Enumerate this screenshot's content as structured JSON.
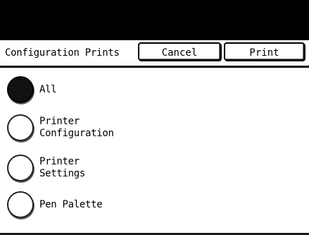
{
  "header": {
    "title": "Configuration Prints",
    "cancel_label": "Cancel",
    "print_label": "Print"
  },
  "options": [
    {
      "line1": "All",
      "selected": true
    },
    {
      "line1": "Printer",
      "line2": "Configuration",
      "selected": false
    },
    {
      "line1": "Printer",
      "line2": "Settings",
      "selected": false
    },
    {
      "line1": "Pen Palette",
      "selected": false
    }
  ],
  "colors": {
    "top_bar": "#000000",
    "background": "#ffffff",
    "selected_radio": "#111111"
  }
}
